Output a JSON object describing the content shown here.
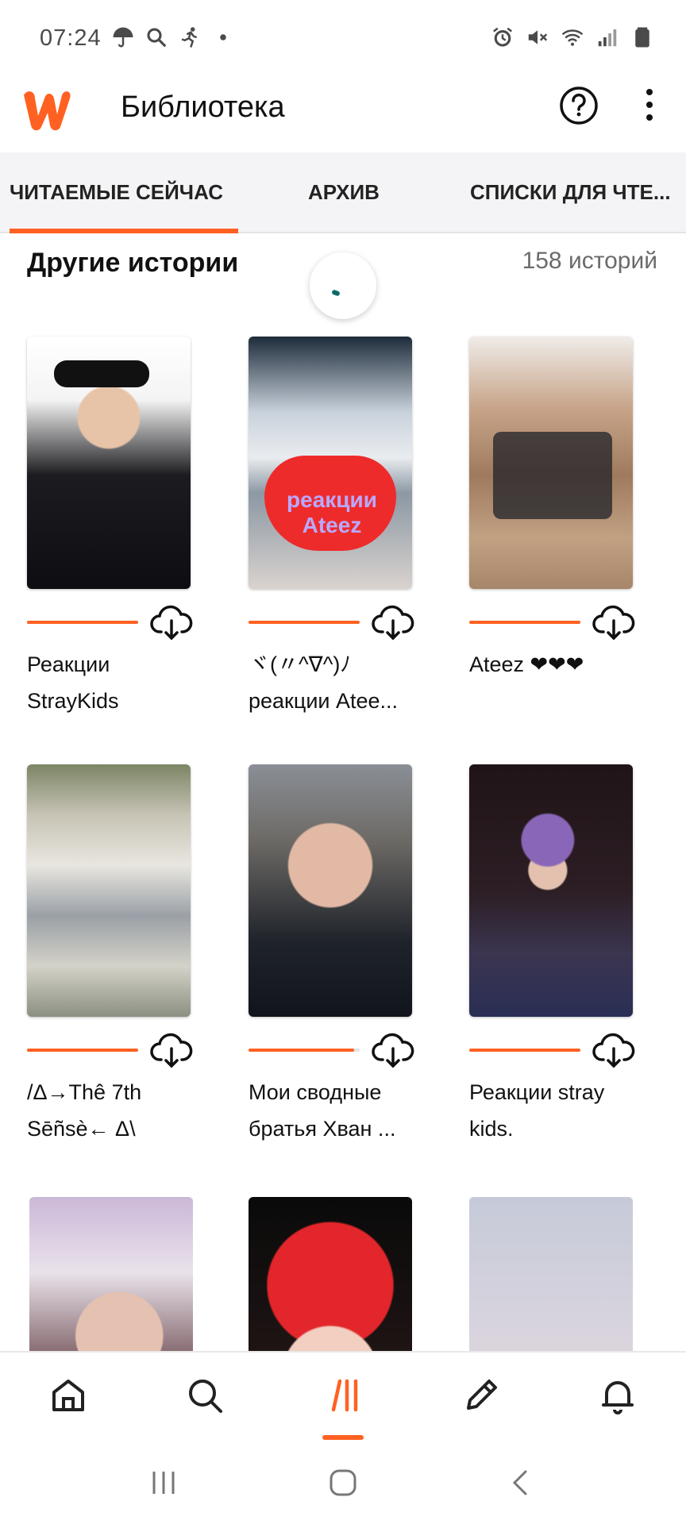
{
  "status_bar": {
    "time": "07:24",
    "left_icons": [
      "umbrella-icon",
      "search-icon",
      "runner-icon",
      "dot-icon"
    ],
    "right_icons": [
      "alarm-icon",
      "mute-icon",
      "wifi-icon",
      "signal-icon",
      "battery-icon"
    ]
  },
  "app_bar": {
    "title": "Библиотека",
    "logo": "wattpad-w-logo",
    "help_icon": "help-circle-icon",
    "more_icon": "more-vert-icon"
  },
  "tabs": [
    {
      "label": "ЧИТАЕМЫЕ СЕЙЧАС",
      "active": true
    },
    {
      "label": "АРХИВ",
      "active": false
    },
    {
      "label": "СПИСКИ ДЛЯ ЧТЕ...",
      "active": false
    }
  ],
  "section": {
    "title": "Другие истории",
    "count": "158 историй"
  },
  "stories": [
    {
      "title": "Реакции StrayKids",
      "progress": 1.0
    },
    {
      "title": "ヾ(〃^∇^)ﾉ реакции Atee...",
      "progress": 1.0
    },
    {
      "title": "Ateez ❤❤❤",
      "progress": 1.0
    },
    {
      "title": "/Δ→Thê 7th Sēñsè← Δ\\",
      "progress": 1.0
    },
    {
      "title": "Мои сводные братья Хван ...",
      "progress": 0.95
    },
    {
      "title": "Реакции stray kids.",
      "progress": 1.0
    },
    {
      "title": "",
      "progress": 0
    },
    {
      "title": "",
      "progress": 0
    },
    {
      "title": "",
      "progress": 0
    }
  ],
  "bottom_nav": [
    {
      "icon": "home-icon",
      "active": false
    },
    {
      "icon": "search-icon",
      "active": false
    },
    {
      "icon": "library-icon",
      "active": true
    },
    {
      "icon": "pencil-icon",
      "active": false
    },
    {
      "icon": "bell-icon",
      "active": false
    }
  ],
  "colors": {
    "accent": "#ff6122"
  }
}
